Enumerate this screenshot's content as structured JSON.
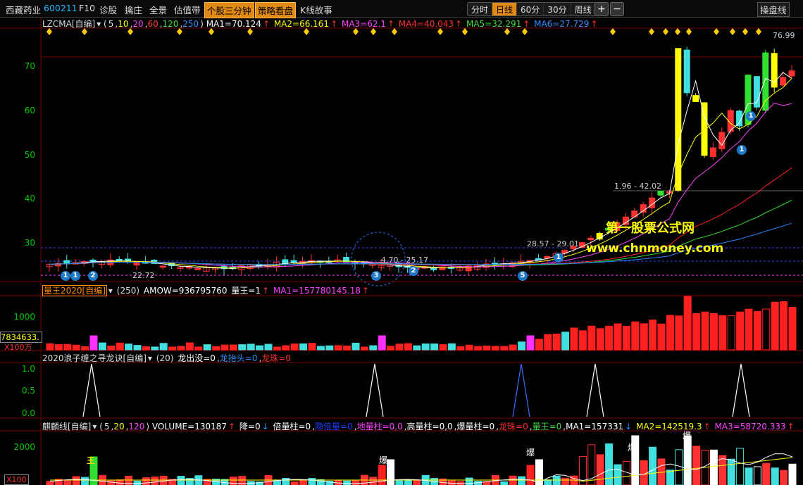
{
  "topbar": {
    "stock_name": "西藏药业",
    "stock_code": "600211",
    "f10": "F10",
    "diagnose": "诊股",
    "grab": "擒庄",
    "panorama": "全景",
    "valuation": "估值带",
    "minute3": "个股三分钟",
    "strategy": "策略看盘",
    "kline_story": "K线故事",
    "periods": [
      "分时",
      "日线",
      "60分",
      "30分",
      "周线"
    ],
    "active_period": "日线",
    "plus": "+",
    "minus": "−",
    "trade_line": "操盘线"
  },
  "main_panel": {
    "indicator_name": "LZCMA[自编]",
    "params": [
      "5",
      "10",
      "20",
      "60",
      "120",
      "250"
    ],
    "ma1": "MA1=70.124",
    "ma2": "MA2=66.161",
    "ma3": "MA3=62.1",
    "ma4": "MA4=40.043",
    "ma5": "MA5=32.291",
    "ma6": "MA6=27.729",
    "y_ticks": [
      "70",
      "60",
      "50",
      "40",
      "30"
    ],
    "annotations": {
      "high": "76.99",
      "range1": "1.96 - 42.02",
      "range2": "28.57 - 29.01",
      "low1": "22.72",
      "range3": "4.70 - 25.17"
    },
    "markers": [
      "1",
      "1",
      "2",
      "3",
      "2",
      "5",
      "1",
      "1",
      "1"
    ],
    "watermark1": "第一股票公式网",
    "watermark2": "www.chnmoney.com",
    "colors": {
      "ma1": "#ffffff",
      "ma2": "#ffff00",
      "ma3": "#ff40ff",
      "ma4": "#ff2020",
      "ma5": "#20e020",
      "ma6": "#2080ff"
    }
  },
  "volume_panel": {
    "indicator_name": "量王2020[自编]",
    "param": "(250)",
    "amow": "AMOW=936795760",
    "king": "量王=1",
    "ma1": "MA1=157780145.18",
    "y_tick": "1000",
    "last_value": "7834633.",
    "unit": "X100万"
  },
  "dragon_panel": {
    "indicator_name": "2020浪子缠之寻龙诀[自编]",
    "param": "(20)",
    "out": "龙出没=0",
    "head": "龙抬头=0",
    "pearl": "龙珠=0",
    "y_ticks": [
      "1.0",
      "0.5",
      "0.0"
    ]
  },
  "kirin_panel": {
    "indicator_name": "麒麟线[自编]",
    "params": [
      "5",
      "20",
      "120"
    ],
    "volume": "VOLUME=130187",
    "fall": "降=0",
    "double": "倍量柱=0",
    "hidden": "隐倍量=0",
    "ground": "地量柱=0,0",
    "high": "高量柱=0,0",
    "burst": "爆量柱=0",
    "pearl": "龙珠=0",
    "king": "量王=0",
    "ma1": "MA1=157331",
    "ma2": "MA2=142519.3",
    "ma3": "MA3=58720.333",
    "y_tick": "2000",
    "unit": "X100",
    "labels": [
      "王",
      "爆",
      "爆",
      "爆",
      "爆"
    ]
  }
}
